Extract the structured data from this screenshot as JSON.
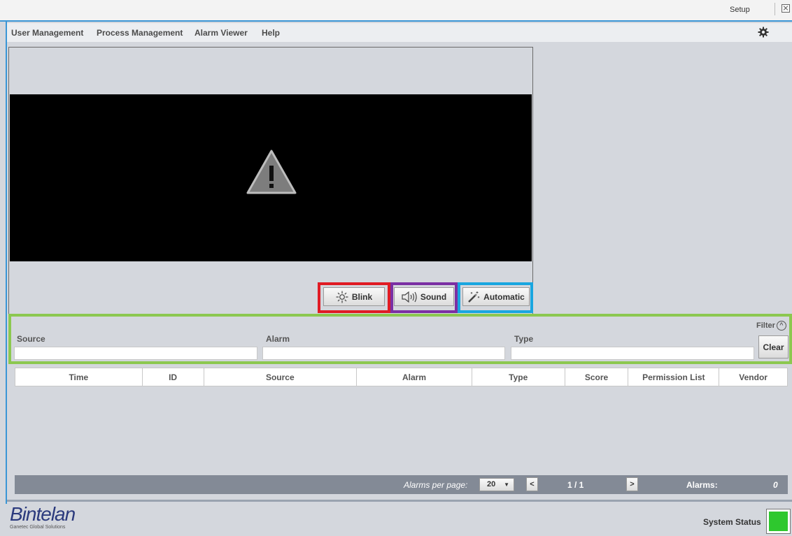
{
  "titlebar": {
    "setup_label": "Setup"
  },
  "menu": {
    "items": [
      "User Management",
      "Process Management",
      "Alarm Viewer",
      "Help"
    ]
  },
  "controls": {
    "blink_label": "Blink",
    "sound_label": "Sound",
    "automatic_label": "Automatic",
    "highlight_colors": {
      "blink": "#e01b24",
      "sound": "#7b2fa3",
      "automatic": "#19a6e0",
      "filter": "#8cc850"
    }
  },
  "filter": {
    "source_label": "Source",
    "alarm_label": "Alarm",
    "type_label": "Type",
    "toggle_label": "Filter",
    "clear_label": "Clear",
    "source_value": "",
    "alarm_value": "",
    "type_value": ""
  },
  "table": {
    "columns": [
      "Time",
      "ID",
      "Source",
      "Alarm",
      "Type",
      "Score",
      "Permission List",
      "Vendor"
    ],
    "rows": []
  },
  "pager": {
    "per_page_label": "Alarms per page:",
    "per_page_value": "20",
    "prev_label": "<",
    "next_label": ">",
    "pages_label": "1  /  1",
    "alarms_label": "Alarms:",
    "alarms_count": "0"
  },
  "footer": {
    "logo_name": "Bintelan",
    "logo_sub": "Ganetec Global Solutions",
    "system_status_label": "System Status",
    "status_color": "#2ec82e"
  }
}
